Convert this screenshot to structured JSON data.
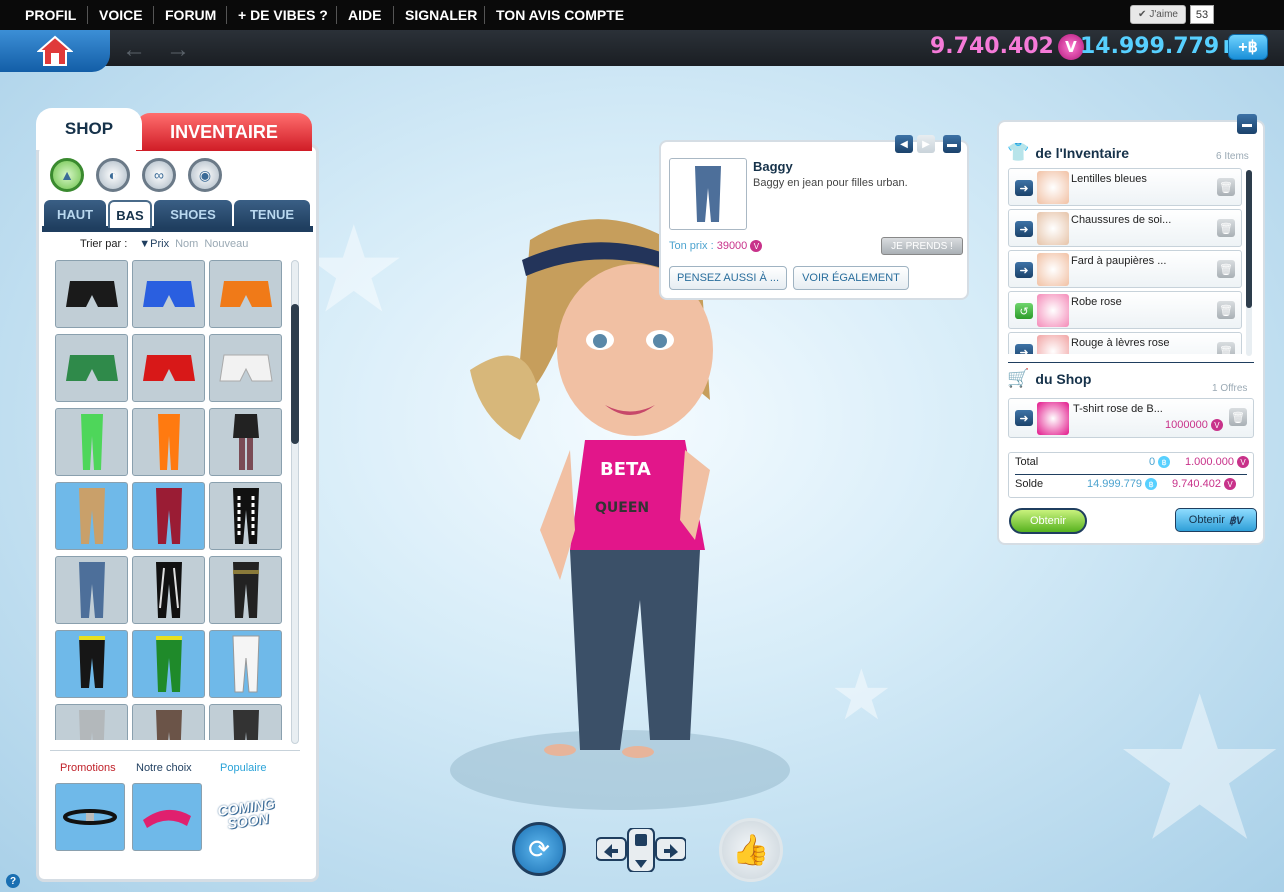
{
  "top_nav": {
    "items": [
      "PROFIL",
      "VOICE",
      "FORUM",
      "+ DE VIBES ?",
      "AIDE",
      "SIGNALER",
      "TON AVIS COMPTE"
    ],
    "like_label": "J'aime",
    "like_count": "53"
  },
  "currency": {
    "vibes": "9.740.402",
    "coins": "14.999.779",
    "add_label": "+฿"
  },
  "shop": {
    "tab_shop": "SHOP",
    "tab_inventory": "INVENTAIRE",
    "subtabs": [
      "HAUT",
      "BAS",
      "SHOES",
      "TENUE"
    ],
    "active_subtab": "BAS",
    "sort_label": "Trier par :",
    "sort_options": [
      "▼Prix",
      "Nom",
      "Nouveau"
    ],
    "promo_tabs": [
      "Promotions",
      "Notre choix",
      "Populaire"
    ],
    "coming_soon": "COMING SOON",
    "colors": {
      "accent_red": "#d01c26",
      "navy": "#1f3e5f",
      "item_bg": "#c1ced6",
      "item_bg_blue": "#6fb9e9"
    }
  },
  "item_popup": {
    "name": "Baggy",
    "description": "Baggy en jean pour filles urban.",
    "price_label": "Ton prix :",
    "price_value": "39000",
    "take_button": "JE PRENDS !",
    "button_also": "PENSEZ AUSSI À ...",
    "button_see": "VOIR ÉGALEMENT"
  },
  "cart": {
    "inventory_title": "de l'Inventaire",
    "inventory_count": "6 Items",
    "inventory_items": [
      {
        "label": "Lentilles bleues",
        "action": "arrow"
      },
      {
        "label": "Chaussures de soi...",
        "action": "arrow"
      },
      {
        "label": "Fard à paupières ...",
        "action": "arrow"
      },
      {
        "label": "Robe rose",
        "action": "green"
      },
      {
        "label": "Rouge à lèvres rose",
        "action": "arrow"
      }
    ],
    "shop_title": "du Shop",
    "shop_count": "1 Offres",
    "shop_items": [
      {
        "label": "T-shirt rose de B...",
        "price": "1000000"
      }
    ],
    "total_label": "Total",
    "total_coins": "0",
    "total_vibes": "1.000.000",
    "balance_label": "Solde",
    "balance_coins": "14.999.779",
    "balance_vibes": "9.740.402",
    "get_vibes_button": "Obtenir",
    "get_coins_button": "Obtenir"
  },
  "help_label": "?"
}
